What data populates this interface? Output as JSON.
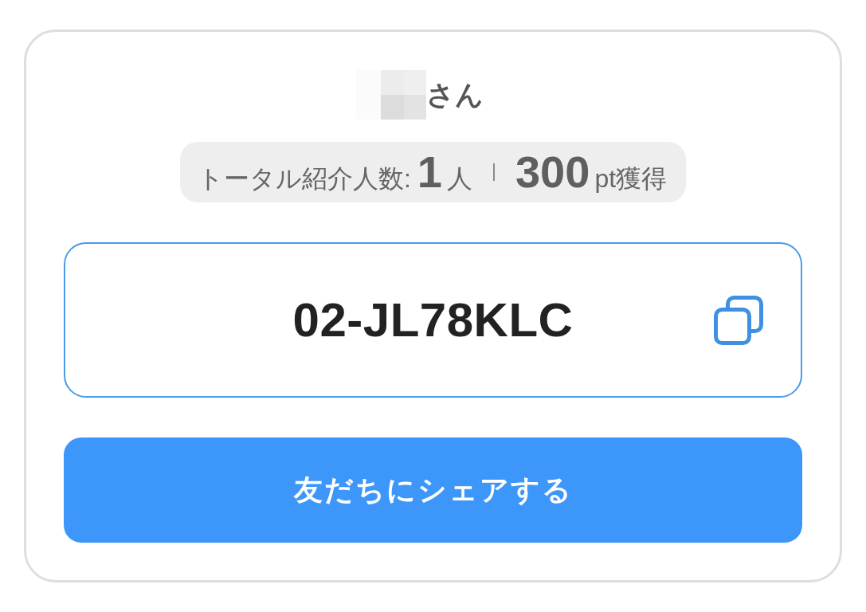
{
  "greeting": {
    "honorific": "さん"
  },
  "stats": {
    "label": "トータル紹介人数:",
    "count": "1",
    "count_unit": "人",
    "points": "300",
    "points_unit": "pt獲得"
  },
  "referral_code": {
    "code": "02-JL78KLC"
  },
  "share_button": {
    "label": "友だちにシェアする"
  }
}
